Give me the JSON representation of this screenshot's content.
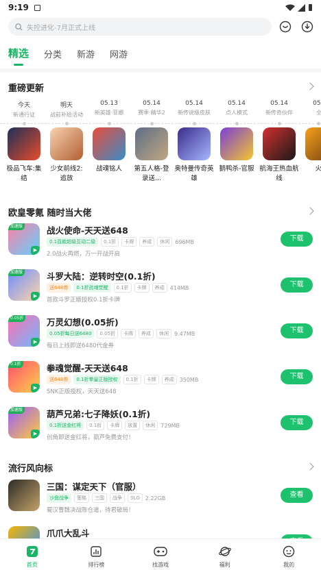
{
  "status": {
    "time": "9:19"
  },
  "search": {
    "placeholder": "失控进化-7月正式上线"
  },
  "tabs": [
    {
      "label": "精选",
      "active": true
    },
    {
      "label": "分类"
    },
    {
      "label": "新游"
    },
    {
      "label": "网游"
    }
  ],
  "sections": {
    "update": "重磅更新",
    "lucky": "欧皇零氪 随时当大佬",
    "trend": "流行风向标"
  },
  "dates": [
    {
      "date": "今天",
      "sub": "新通行证"
    },
    {
      "date": "明天",
      "sub": "战前补给活动"
    },
    {
      "date": "05.13",
      "sub": "新英雄·菲娜"
    },
    {
      "date": "05.14",
      "sub": "赛季·精华2"
    },
    {
      "date": "05.14",
      "sub": "新传说级皮肤"
    },
    {
      "date": "05.14",
      "sub": "点人模式"
    },
    {
      "date": "05.14",
      "sub": "新传奇伙伴"
    },
    {
      "date": "05.14",
      "sub": "全新"
    }
  ],
  "games": [
    {
      "name": "极品飞车:集结",
      "color1": "#1c2f59",
      "color2": "#e84c2a"
    },
    {
      "name": "少女前线2: 追放",
      "color1": "#f7d2b0",
      "color2": "#b15f32"
    },
    {
      "name": "战魂铭人",
      "color1": "#e84b3a",
      "color2": "#3a8cc7"
    },
    {
      "name": "第五人格-登录送...",
      "color1": "#5f6d86",
      "color2": "#c0a882"
    },
    {
      "name": "奥特曼传奇英雄",
      "color1": "#3a2b8c",
      "color2": "#a7b8ff"
    },
    {
      "name": "鹅鸭杀-官服",
      "color1": "#7a3fd6",
      "color2": "#f5c52e"
    },
    {
      "name": "航海王热血航线",
      "color1": "#d32f2f",
      "color2": "#1a1a1a"
    },
    {
      "name": "火影",
      "color1": "#f7a21b",
      "color2": "#6c3a12"
    }
  ],
  "lucky_list": [
    {
      "title": "战火使命-天天送648",
      "tags": [
        {
          "t": "0.1百款超级互动二级",
          "k": "g"
        },
        {
          "t": "0.1折",
          "k": ""
        },
        {
          "t": "卡牌",
          "k": ""
        },
        {
          "t": "养成",
          "k": ""
        },
        {
          "t": "休闲",
          "k": ""
        }
      ],
      "size": "696MB",
      "desc": "2.0战火再燃，万一开战开启",
      "badge": "加速版",
      "btn": "下载",
      "c1": "#ff7fa3",
      "c2": "#5fd2ff"
    },
    {
      "title": "斗罗大陆：逆转时空(0.1折)",
      "tags": [
        {
          "t": "送648券",
          "k": "o"
        },
        {
          "t": "0.1折武魂觉醒",
          "k": "g"
        },
        {
          "t": "0.1折",
          "k": ""
        },
        {
          "t": "卡牌",
          "k": ""
        },
        {
          "t": "养成",
          "k": ""
        }
      ],
      "size": "414MB",
      "desc": "首款斗罗正版授权0.1折卡牌",
      "badge": "加速版",
      "btn": "下载",
      "c1": "#6b8cff",
      "c2": "#ffd6a8"
    },
    {
      "title": "万灵幻想(0.05折)",
      "tags": [
        {
          "t": "0.05折每日送6480",
          "k": "g"
        },
        {
          "t": "0.05折",
          "k": ""
        },
        {
          "t": "卡牌",
          "k": ""
        },
        {
          "t": "养成",
          "k": ""
        },
        {
          "t": "休闲",
          "k": ""
        }
      ],
      "size": "9.47MB",
      "desc": "每日上线即送6480代金券",
      "badge": "0.05折",
      "btn": "下载",
      "c1": "#ff6fb0",
      "c2": "#6fb8ff"
    },
    {
      "title": "拳魂觉醒-天天送648",
      "tags": [
        {
          "t": "送648券",
          "k": "o"
        },
        {
          "t": "0.1折拳皇正版授权",
          "k": "g"
        },
        {
          "t": "0.1折",
          "k": ""
        },
        {
          "t": "卡牌",
          "k": ""
        },
        {
          "t": "养成",
          "k": ""
        }
      ],
      "size": "350MB",
      "desc": "SNK正版授权，天天送648",
      "badge": "0.1折",
      "btn": "下载",
      "c1": "#ff4d6d",
      "c2": "#ffd24d"
    },
    {
      "title": "葫芦兄弟:七子降妖(0.1折)",
      "tags": [
        {
          "t": "0.1折送金红将",
          "k": "g"
        },
        {
          "t": "0.1折",
          "k": ""
        },
        {
          "t": "卡牌",
          "k": ""
        },
        {
          "t": "放置",
          "k": ""
        },
        {
          "t": "休闲",
          "k": ""
        }
      ],
      "size": "729MB",
      "desc": "创角即送金红将，葫芦免费支付！",
      "badge": "加速版",
      "btn": "下载",
      "c1": "#9a5bff",
      "c2": "#ffcc3a"
    }
  ],
  "trend_list": [
    {
      "title": "三国：谋定天下（官服）",
      "tags": [
        {
          "t": "沙盘战争",
          "k": "g"
        },
        {
          "t": "策略",
          "k": ""
        },
        {
          "t": "三国",
          "k": ""
        },
        {
          "t": "战争",
          "k": ""
        },
        {
          "t": "SLG",
          "k": ""
        }
      ],
      "size": "2.22GB",
      "desc": "蜀汉曹魏决战陈仓道，待君破局！",
      "btn": "查看",
      "c1": "#2d2a26",
      "c2": "#c4a36a"
    },
    {
      "title": "爪爪大乱斗",
      "tags": [],
      "size": "",
      "desc": "",
      "btn": "查看",
      "c1": "#f5b700",
      "c2": "#2f8cff"
    }
  ],
  "nav": [
    {
      "label": "首页",
      "icon": "home-icon",
      "active": true
    },
    {
      "label": "排行榜",
      "icon": "ranking-icon"
    },
    {
      "label": "找游戏",
      "icon": "gamepad-icon"
    },
    {
      "label": "福利",
      "icon": "planet-icon"
    },
    {
      "label": "我的",
      "icon": "profile-icon"
    }
  ],
  "colors": {
    "accent": "#19b565",
    "button": "#1ec26e"
  }
}
